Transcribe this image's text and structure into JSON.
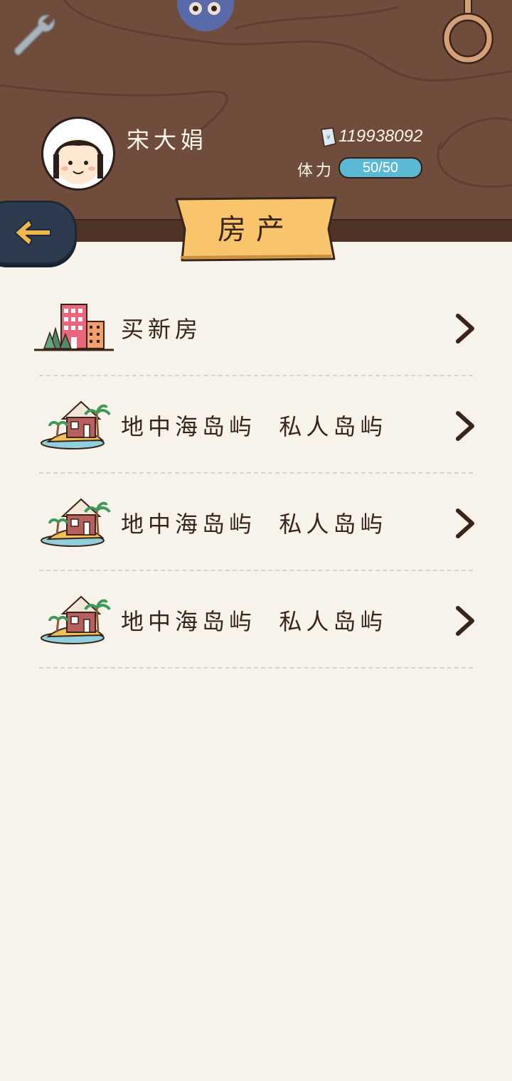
{
  "header": {
    "player_name": "宋大娟",
    "money": "119938092",
    "stamina_label": "体力",
    "stamina_text": "50/50",
    "stamina_fraction": 1.0,
    "icons": [
      "wrench-icon",
      "blob-character-icon",
      "ring-icon",
      "money-bill-icon",
      "avatar"
    ]
  },
  "banner": {
    "title": "房产"
  },
  "nav": {
    "back_icon": "back-arrow-icon"
  },
  "list": [
    {
      "label": "买新房",
      "icon": "city-buildings-icon"
    },
    {
      "label": "地中海岛屿  私人岛屿",
      "icon": "island-house-icon"
    },
    {
      "label": "地中海岛屿  私人岛屿",
      "icon": "island-house-icon"
    },
    {
      "label": "地中海岛屿  私人岛屿",
      "icon": "island-house-icon"
    }
  ],
  "colors": {
    "header_wood": "#704c3c",
    "background": "#f7f3ea",
    "banner": "#f8c46c",
    "stamina": "#5cb9d3",
    "back_button": "#2d3b4f",
    "back_arrow": "#f2b64e"
  }
}
